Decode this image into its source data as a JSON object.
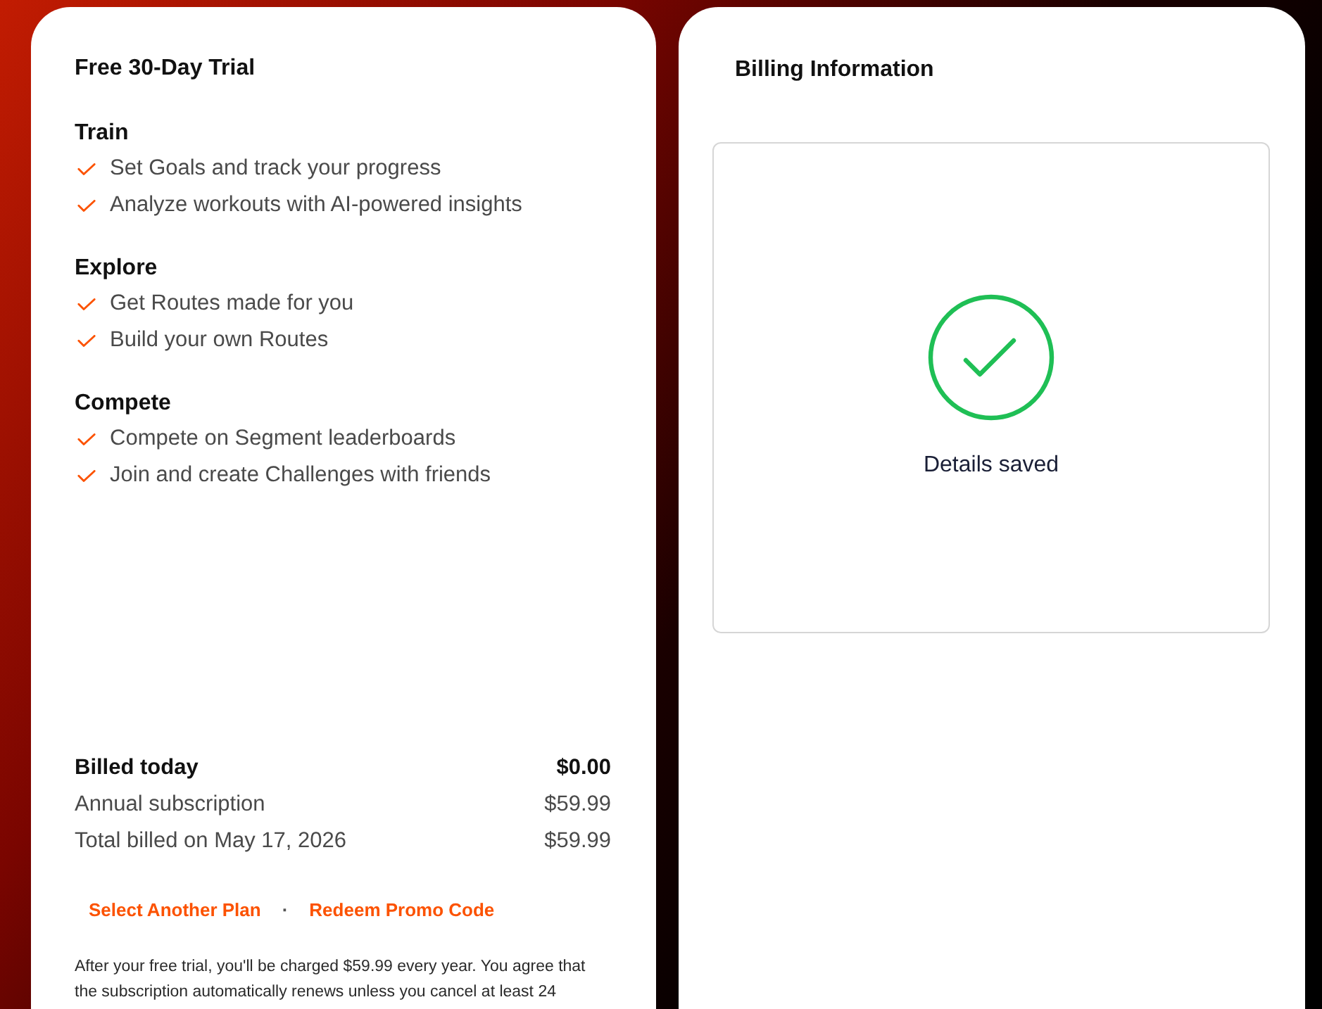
{
  "plan_card": {
    "title": "Free 30-Day Trial",
    "sections": [
      {
        "heading": "Train",
        "features": [
          "Set Goals and track your progress",
          "Analyze workouts with AI-powered insights"
        ]
      },
      {
        "heading": "Explore",
        "features": [
          "Get Routes made for you",
          "Build your own Routes"
        ]
      },
      {
        "heading": "Compete",
        "features": [
          "Compete on Segment leaderboards",
          "Join and create Challenges with friends"
        ]
      }
    ],
    "billing_lines": [
      {
        "kind": "summary",
        "label": "Billed today",
        "amount": "$0.00"
      },
      {
        "kind": "item",
        "label": "Annual subscription",
        "amount": "$59.99"
      },
      {
        "kind": "item",
        "label": "Total billed on May 17, 2026",
        "amount": "$59.99"
      }
    ],
    "links": [
      "Select Another Plan",
      "Redeem Promo Code"
    ],
    "separator": "·",
    "disclaimer": "After your free trial, you'll be charged $59.99 every year. You agree that the subscription automatically renews unless you cancel at least 24"
  },
  "billing_card": {
    "title": "Billing Information",
    "status": {
      "kind": "success",
      "message": "Details saved"
    }
  }
}
